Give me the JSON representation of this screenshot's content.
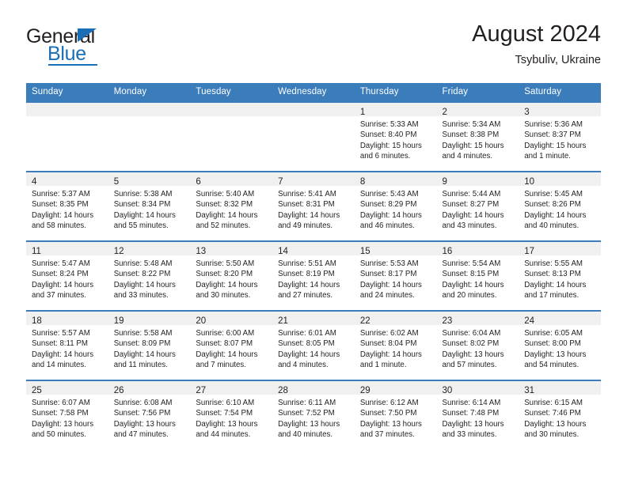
{
  "brand": {
    "name_top": "General",
    "name_bottom": "Blue",
    "accent_color": "#1a6eb5",
    "triangle_icon": "triangle-icon"
  },
  "header": {
    "title": "August 2024",
    "subtitle": "Tsybuliv, Ukraine"
  },
  "theme": {
    "header_row_bg": "#3b7cba",
    "daynum_band_bg": "#f0f0f0",
    "grid_line": "#3b7cba",
    "text": "#231f20"
  },
  "calendar": {
    "weekday_headers": [
      "Sunday",
      "Monday",
      "Tuesday",
      "Wednesday",
      "Thursday",
      "Friday",
      "Saturday"
    ],
    "weeks": [
      [
        {
          "empty": true
        },
        {
          "empty": true
        },
        {
          "empty": true
        },
        {
          "empty": true
        },
        {
          "day": "1",
          "sunrise": "Sunrise: 5:33 AM",
          "sunset": "Sunset: 8:40 PM",
          "daylight_1": "Daylight: 15 hours",
          "daylight_2": "and 6 minutes."
        },
        {
          "day": "2",
          "sunrise": "Sunrise: 5:34 AM",
          "sunset": "Sunset: 8:38 PM",
          "daylight_1": "Daylight: 15 hours",
          "daylight_2": "and 4 minutes."
        },
        {
          "day": "3",
          "sunrise": "Sunrise: 5:36 AM",
          "sunset": "Sunset: 8:37 PM",
          "daylight_1": "Daylight: 15 hours",
          "daylight_2": "and 1 minute."
        }
      ],
      [
        {
          "day": "4",
          "sunrise": "Sunrise: 5:37 AM",
          "sunset": "Sunset: 8:35 PM",
          "daylight_1": "Daylight: 14 hours",
          "daylight_2": "and 58 minutes."
        },
        {
          "day": "5",
          "sunrise": "Sunrise: 5:38 AM",
          "sunset": "Sunset: 8:34 PM",
          "daylight_1": "Daylight: 14 hours",
          "daylight_2": "and 55 minutes."
        },
        {
          "day": "6",
          "sunrise": "Sunrise: 5:40 AM",
          "sunset": "Sunset: 8:32 PM",
          "daylight_1": "Daylight: 14 hours",
          "daylight_2": "and 52 minutes."
        },
        {
          "day": "7",
          "sunrise": "Sunrise: 5:41 AM",
          "sunset": "Sunset: 8:31 PM",
          "daylight_1": "Daylight: 14 hours",
          "daylight_2": "and 49 minutes."
        },
        {
          "day": "8",
          "sunrise": "Sunrise: 5:43 AM",
          "sunset": "Sunset: 8:29 PM",
          "daylight_1": "Daylight: 14 hours",
          "daylight_2": "and 46 minutes."
        },
        {
          "day": "9",
          "sunrise": "Sunrise: 5:44 AM",
          "sunset": "Sunset: 8:27 PM",
          "daylight_1": "Daylight: 14 hours",
          "daylight_2": "and 43 minutes."
        },
        {
          "day": "10",
          "sunrise": "Sunrise: 5:45 AM",
          "sunset": "Sunset: 8:26 PM",
          "daylight_1": "Daylight: 14 hours",
          "daylight_2": "and 40 minutes."
        }
      ],
      [
        {
          "day": "11",
          "sunrise": "Sunrise: 5:47 AM",
          "sunset": "Sunset: 8:24 PM",
          "daylight_1": "Daylight: 14 hours",
          "daylight_2": "and 37 minutes."
        },
        {
          "day": "12",
          "sunrise": "Sunrise: 5:48 AM",
          "sunset": "Sunset: 8:22 PM",
          "daylight_1": "Daylight: 14 hours",
          "daylight_2": "and 33 minutes."
        },
        {
          "day": "13",
          "sunrise": "Sunrise: 5:50 AM",
          "sunset": "Sunset: 8:20 PM",
          "daylight_1": "Daylight: 14 hours",
          "daylight_2": "and 30 minutes."
        },
        {
          "day": "14",
          "sunrise": "Sunrise: 5:51 AM",
          "sunset": "Sunset: 8:19 PM",
          "daylight_1": "Daylight: 14 hours",
          "daylight_2": "and 27 minutes."
        },
        {
          "day": "15",
          "sunrise": "Sunrise: 5:53 AM",
          "sunset": "Sunset: 8:17 PM",
          "daylight_1": "Daylight: 14 hours",
          "daylight_2": "and 24 minutes."
        },
        {
          "day": "16",
          "sunrise": "Sunrise: 5:54 AM",
          "sunset": "Sunset: 8:15 PM",
          "daylight_1": "Daylight: 14 hours",
          "daylight_2": "and 20 minutes."
        },
        {
          "day": "17",
          "sunrise": "Sunrise: 5:55 AM",
          "sunset": "Sunset: 8:13 PM",
          "daylight_1": "Daylight: 14 hours",
          "daylight_2": "and 17 minutes."
        }
      ],
      [
        {
          "day": "18",
          "sunrise": "Sunrise: 5:57 AM",
          "sunset": "Sunset: 8:11 PM",
          "daylight_1": "Daylight: 14 hours",
          "daylight_2": "and 14 minutes."
        },
        {
          "day": "19",
          "sunrise": "Sunrise: 5:58 AM",
          "sunset": "Sunset: 8:09 PM",
          "daylight_1": "Daylight: 14 hours",
          "daylight_2": "and 11 minutes."
        },
        {
          "day": "20",
          "sunrise": "Sunrise: 6:00 AM",
          "sunset": "Sunset: 8:07 PM",
          "daylight_1": "Daylight: 14 hours",
          "daylight_2": "and 7 minutes."
        },
        {
          "day": "21",
          "sunrise": "Sunrise: 6:01 AM",
          "sunset": "Sunset: 8:05 PM",
          "daylight_1": "Daylight: 14 hours",
          "daylight_2": "and 4 minutes."
        },
        {
          "day": "22",
          "sunrise": "Sunrise: 6:02 AM",
          "sunset": "Sunset: 8:04 PM",
          "daylight_1": "Daylight: 14 hours",
          "daylight_2": "and 1 minute."
        },
        {
          "day": "23",
          "sunrise": "Sunrise: 6:04 AM",
          "sunset": "Sunset: 8:02 PM",
          "daylight_1": "Daylight: 13 hours",
          "daylight_2": "and 57 minutes."
        },
        {
          "day": "24",
          "sunrise": "Sunrise: 6:05 AM",
          "sunset": "Sunset: 8:00 PM",
          "daylight_1": "Daylight: 13 hours",
          "daylight_2": "and 54 minutes."
        }
      ],
      [
        {
          "day": "25",
          "sunrise": "Sunrise: 6:07 AM",
          "sunset": "Sunset: 7:58 PM",
          "daylight_1": "Daylight: 13 hours",
          "daylight_2": "and 50 minutes."
        },
        {
          "day": "26",
          "sunrise": "Sunrise: 6:08 AM",
          "sunset": "Sunset: 7:56 PM",
          "daylight_1": "Daylight: 13 hours",
          "daylight_2": "and 47 minutes."
        },
        {
          "day": "27",
          "sunrise": "Sunrise: 6:10 AM",
          "sunset": "Sunset: 7:54 PM",
          "daylight_1": "Daylight: 13 hours",
          "daylight_2": "and 44 minutes."
        },
        {
          "day": "28",
          "sunrise": "Sunrise: 6:11 AM",
          "sunset": "Sunset: 7:52 PM",
          "daylight_1": "Daylight: 13 hours",
          "daylight_2": "and 40 minutes."
        },
        {
          "day": "29",
          "sunrise": "Sunrise: 6:12 AM",
          "sunset": "Sunset: 7:50 PM",
          "daylight_1": "Daylight: 13 hours",
          "daylight_2": "and 37 minutes."
        },
        {
          "day": "30",
          "sunrise": "Sunrise: 6:14 AM",
          "sunset": "Sunset: 7:48 PM",
          "daylight_1": "Daylight: 13 hours",
          "daylight_2": "and 33 minutes."
        },
        {
          "day": "31",
          "sunrise": "Sunrise: 6:15 AM",
          "sunset": "Sunset: 7:46 PM",
          "daylight_1": "Daylight: 13 hours",
          "daylight_2": "and 30 minutes."
        }
      ]
    ]
  }
}
